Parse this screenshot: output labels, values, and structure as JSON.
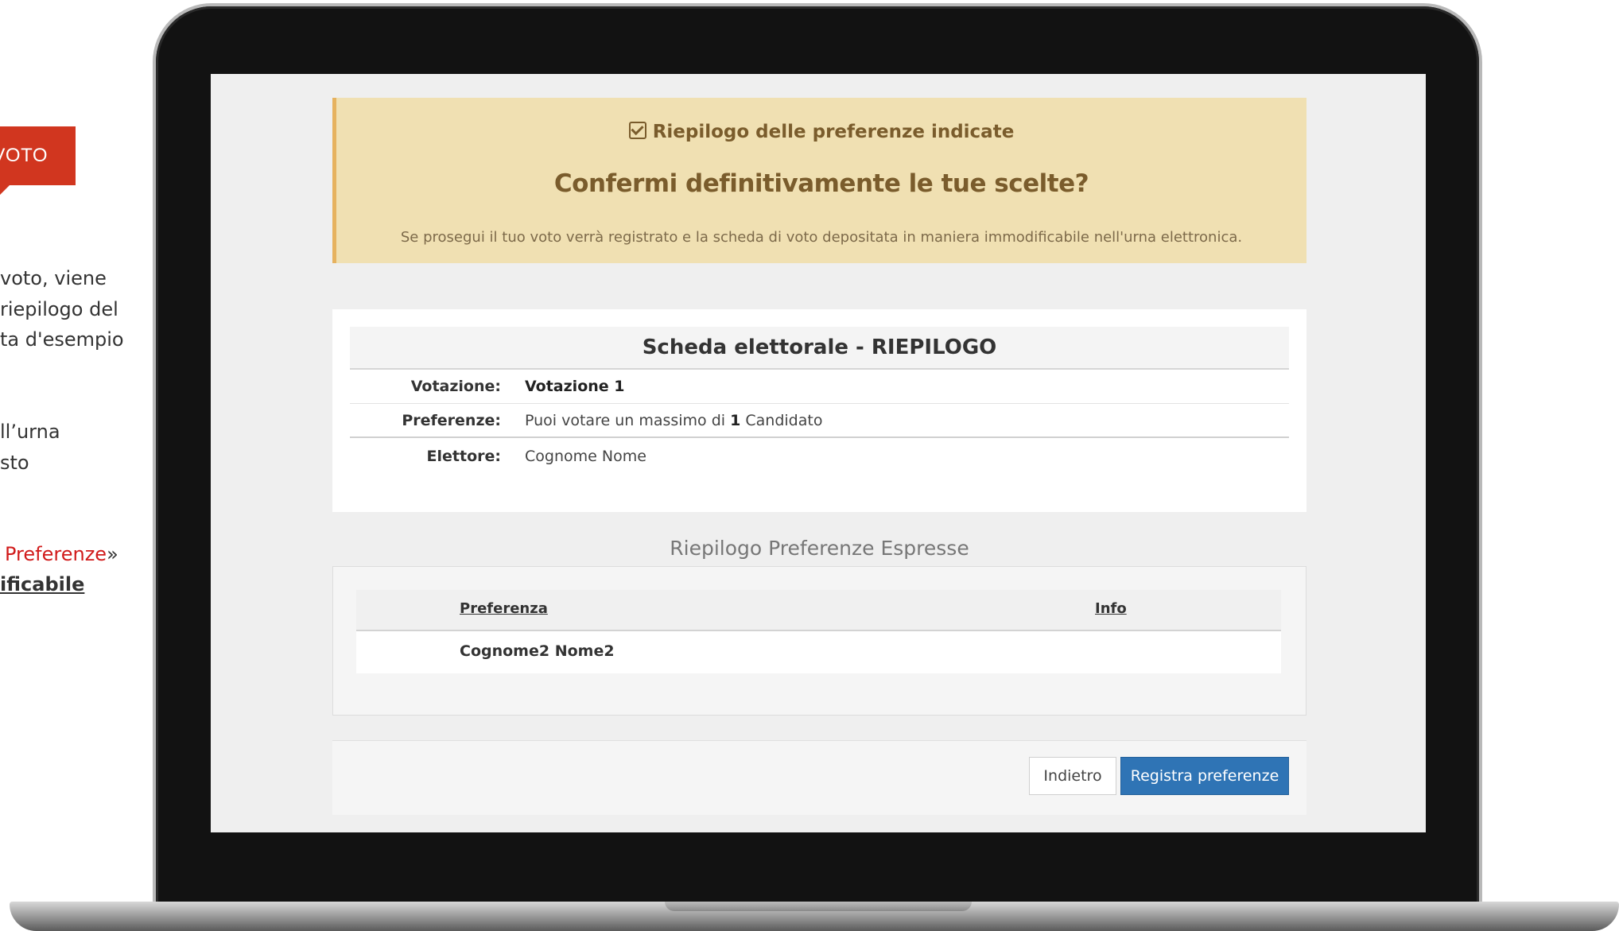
{
  "side": {
    "badge": "VOTO",
    "line1": "voto, viene",
    "line2": "riepilogo del",
    "line3": "ta d'esempio",
    "line4": "ll’urna",
    "line5": "sto",
    "line6_red": "Preferenze",
    "line6_end": "»",
    "line7": "ificabile"
  },
  "alert": {
    "heading": "Riepilogo delle preferenze indicate",
    "title": "Confermi definitivamente le tue scelte?",
    "text": "Se prosegui il tuo voto verrà registrato e la scheda di voto depositata in maniera immodificabile nell'urna elettronica."
  },
  "ballot": {
    "title": "Scheda elettorale - RIEPILOGO",
    "rows": [
      {
        "label": "Votazione:",
        "value": "Votazione 1"
      },
      {
        "label": "Preferenze:",
        "value_pre": "Puoi votare un massimo di ",
        "value_num": "1",
        "value_post": " Candidato"
      },
      {
        "label": "Elettore:",
        "value": "Cognome Nome"
      }
    ]
  },
  "summary": {
    "title": "Riepilogo Preferenze Espresse",
    "col_preference": "Preferenza",
    "col_info": "Info",
    "rows": [
      {
        "name": "Cognome2 Nome2"
      }
    ]
  },
  "buttons": {
    "back": "Indietro",
    "save": "Registra preferenze"
  },
  "colors": {
    "primary": "#2f74b5",
    "warning_bg": "#f0e0b2",
    "badge": "#d1361f"
  }
}
